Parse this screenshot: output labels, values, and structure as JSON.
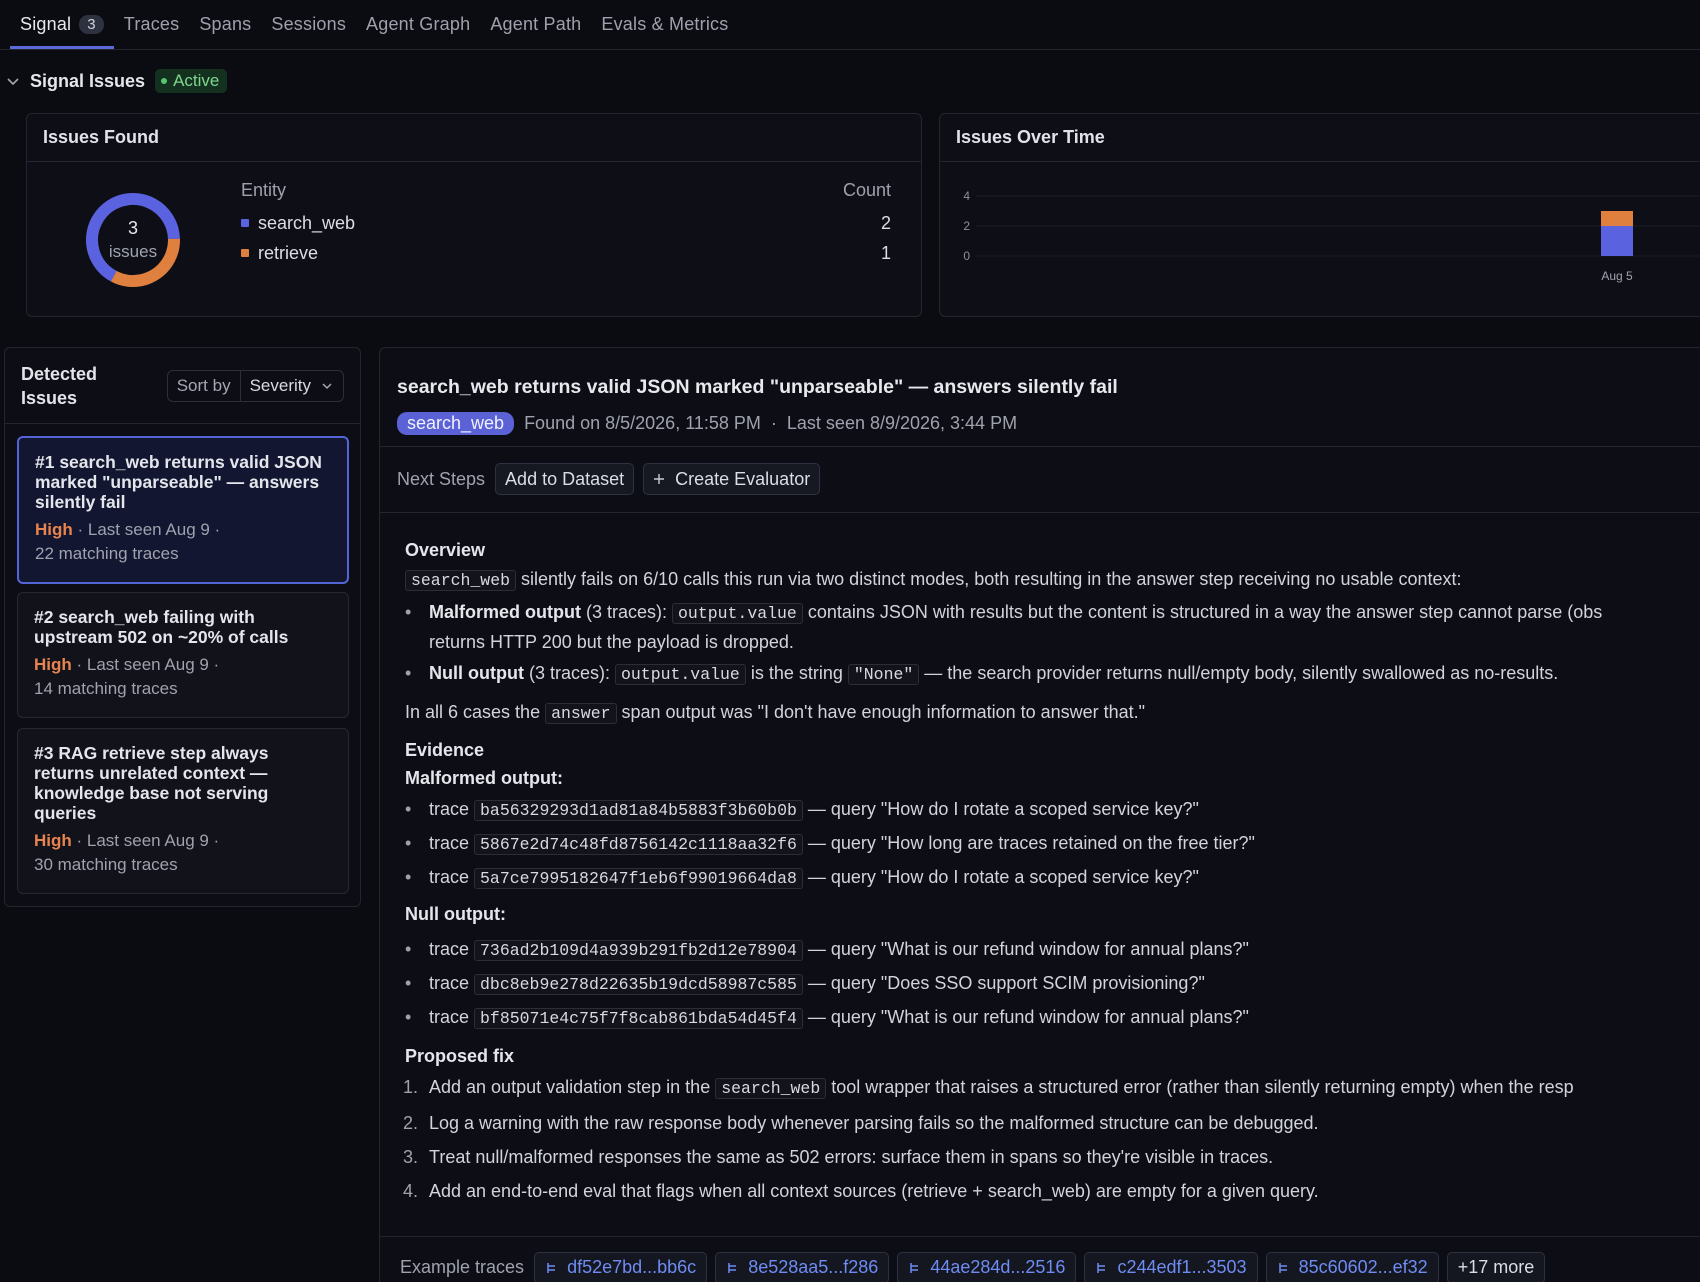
{
  "tabs": [
    {
      "label": "Signal",
      "count": "3"
    },
    {
      "label": "Traces"
    },
    {
      "label": "Spans"
    },
    {
      "label": "Sessions"
    },
    {
      "label": "Agent Graph"
    },
    {
      "label": "Agent Path"
    },
    {
      "label": "Evals & Metrics"
    }
  ],
  "section": {
    "title": "Signal Issues",
    "status": "Active"
  },
  "issues_found": {
    "title": "Issues Found",
    "total": "3",
    "total_label": "issues",
    "col_entity": "Entity",
    "col_count": "Count",
    "rows": [
      {
        "name": "search_web",
        "count": "2",
        "color": "#5b62e0"
      },
      {
        "name": "retrieve",
        "count": "1",
        "color": "#e0803e"
      }
    ]
  },
  "issues_over_time": {
    "title": "Issues Over Time"
  },
  "chart_data": {
    "type": "bar",
    "title": "Issues Over Time",
    "categories": [
      "Aug 5"
    ],
    "series": [
      {
        "name": "search_web",
        "values": [
          2
        ],
        "color": "#5b62e0"
      },
      {
        "name": "retrieve",
        "values": [
          1
        ],
        "color": "#e0803e"
      }
    ],
    "yticks": [
      "4",
      "2",
      "0"
    ],
    "ylim": [
      0,
      4
    ],
    "stacked": true
  },
  "detected": {
    "title": "Detected Issues",
    "sort_label": "Sort by",
    "sort_value": "Severity",
    "items": [
      {
        "title": "#1 search_web returns valid JSON marked \"unparseable\" — answers silently fail",
        "severity": "High",
        "last_seen": "· Last seen Aug 9 ·",
        "traces": "22 matching traces"
      },
      {
        "title": "#2 search_web failing with upstream 502 on ~20% of calls",
        "severity": "High",
        "last_seen": "· Last seen Aug 9 ·",
        "traces": "14 matching traces"
      },
      {
        "title": "#3 RAG retrieve step always returns unrelated context — knowledge base not serving queries",
        "severity": "High",
        "last_seen": "· Last seen Aug 9 ·",
        "traces": "30 matching traces"
      }
    ]
  },
  "detail": {
    "title": "search_web returns valid JSON marked \"unparseable\" — answers silently fail",
    "entity": "search_web",
    "found": "Found on 8/5/2026, 11:58 PM",
    "sep": "·",
    "last_seen": "Last seen 8/9/2026, 3:44 PM",
    "next_steps_label": "Next Steps",
    "add_dataset": "Add to Dataset",
    "create_eval": "Create Evaluator",
    "overview": {
      "heading": "Overview",
      "code1": "search_web",
      "text1": " silently fails on 6/10 calls this run via two distinct modes, both resulting in the answer step receiving no usable context:",
      "b1_bold": "Malformed output",
      "b1_a": " (3 traces): ",
      "b1_code": "output.value",
      "b1_b": " contains JSON with results but the content is structured in a way the answer step cannot parse (obs",
      "b1_c": "returns HTTP 200 but the payload is dropped.",
      "b2_bold": "Null output",
      "b2_a": " (3 traces): ",
      "b2_code": "output.value",
      "b2_b": " is the string ",
      "b2_code2": "\"None\"",
      "b2_c": " — the search provider returns null/empty body, silently swallowed as no-results.",
      "p2_a": "In all 6 cases the ",
      "p2_code": "answer",
      "p2_b": " span output was \"I don't have enough information to answer that.\""
    },
    "evidence": {
      "heading": "Evidence",
      "malformed_heading": "Malformed output:",
      "malformed": [
        {
          "prefix": "trace ",
          "id": "ba56329293d1ad81a84b5883f3b60b0b",
          "query": " — query \"How do I rotate a scoped service key?\""
        },
        {
          "prefix": "trace ",
          "id": "5867e2d74c48fd8756142c1118aa32f6",
          "query": " — query \"How long are traces retained on the free tier?\""
        },
        {
          "prefix": "trace ",
          "id": "5a7ce7995182647f1eb6f99019664da8",
          "query": " — query \"How do I rotate a scoped service key?\""
        }
      ],
      "null_heading": "Null output:",
      "null": [
        {
          "prefix": "trace ",
          "id": "736ad2b109d4a939b291fb2d12e78904",
          "query": " — query \"What is our refund window for annual plans?\""
        },
        {
          "prefix": "trace ",
          "id": "dbc8eb9e278d22635b19dcd58987c585",
          "query": " — query \"Does SSO support SCIM provisioning?\""
        },
        {
          "prefix": "trace ",
          "id": "bf85071e4c75f7f8cab861bda54d45f4",
          "query": " — query \"What is our refund window for annual plans?\""
        }
      ]
    },
    "fix": {
      "heading": "Proposed fix",
      "f1_a": "Add an output validation step in the ",
      "f1_code": "search_web",
      "f1_b": " tool wrapper that raises a structured error (rather than silently returning empty) when the resp",
      "f2": "Log a warning with the raw response body whenever parsing fails so the malformed structure can be debugged.",
      "f3": "Treat null/malformed responses the same as 502 errors: surface them in spans so they're visible in traces.",
      "f4": "Add an end-to-end eval that flags when all context sources (retrieve + search_web) are empty for a given query.",
      "nums": [
        "1.",
        "2.",
        "3.",
        "4."
      ]
    },
    "examples": {
      "label": "Example traces",
      "chips": [
        "df52e7bd...bb6c",
        "8e528aa5...f286",
        "44ae284d...2516",
        "c244edf1...3503",
        "85c60602...ef32"
      ],
      "more": "+17 more"
    }
  }
}
